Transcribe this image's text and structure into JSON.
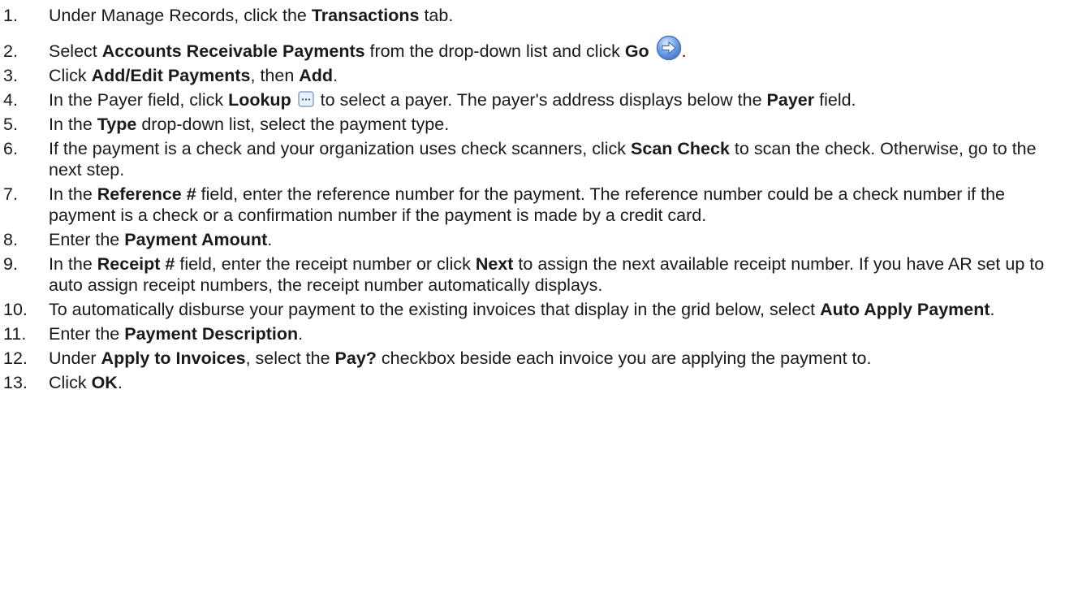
{
  "steps": [
    {
      "num": "1.",
      "parts": [
        {
          "t": "Under Manage Records, click the "
        },
        {
          "t": "Transactions",
          "b": true
        },
        {
          "t": " tab."
        }
      ]
    },
    {
      "num": "2.",
      "parts": [
        {
          "t": "Select "
        },
        {
          "t": "Accounts Receivable Payments",
          "b": true
        },
        {
          "t": " from the drop-down list and click "
        },
        {
          "t": "Go",
          "b": true
        },
        {
          "t": " "
        },
        {
          "icon": "go-arrow-icon"
        },
        {
          "t": "."
        }
      ]
    },
    {
      "num": "3.",
      "parts": [
        {
          "t": "Click "
        },
        {
          "t": "Add/Edit Payments",
          "b": true
        },
        {
          "t": ", then "
        },
        {
          "t": "Add",
          "b": true
        },
        {
          "t": "."
        }
      ]
    },
    {
      "num": "4.",
      "parts": [
        {
          "t": "In the Payer field, click "
        },
        {
          "t": "Lookup",
          "b": true
        },
        {
          "t": " "
        },
        {
          "icon": "lookup-icon"
        },
        {
          "t": " to select a payer. The payer's address displays below the "
        },
        {
          "t": "Payer",
          "b": true
        },
        {
          "t": " field."
        }
      ]
    },
    {
      "num": "5.",
      "parts": [
        {
          "t": "In the "
        },
        {
          "t": "Type",
          "b": true
        },
        {
          "t": " drop-down list, select the payment type."
        }
      ]
    },
    {
      "num": "6.",
      "parts": [
        {
          "t": "If the payment is a check and your organization uses check scanners, click "
        },
        {
          "t": "Scan Check",
          "b": true
        },
        {
          "t": " to scan the check. Otherwise, go to the next step."
        }
      ]
    },
    {
      "num": "7.",
      "parts": [
        {
          "t": "In the "
        },
        {
          "t": "Reference #",
          "b": true
        },
        {
          "t": " field, enter the reference number for the payment. The reference number could be a check number if the payment is a check or a confirmation number if the payment is made by a credit card."
        }
      ]
    },
    {
      "num": "8.",
      "parts": [
        {
          "t": "Enter the "
        },
        {
          "t": "Payment Amount",
          "b": true
        },
        {
          "t": "."
        }
      ]
    },
    {
      "num": "9.",
      "parts": [
        {
          "t": "In the "
        },
        {
          "t": "Receipt #",
          "b": true
        },
        {
          "t": " field, enter the receipt number or click "
        },
        {
          "t": "Next",
          "b": true
        },
        {
          "t": " to assign the next available receipt number. If you have AR set up to auto assign receipt numbers, the receipt number automatically displays."
        }
      ]
    },
    {
      "num": "10.",
      "parts": [
        {
          "t": "To automatically disburse your payment to the existing invoices that display in the grid below, select "
        },
        {
          "t": "Auto Apply Payment",
          "b": true
        },
        {
          "t": "."
        }
      ]
    },
    {
      "num": "11.",
      "parts": [
        {
          "t": "Enter the "
        },
        {
          "t": "Payment Description",
          "b": true
        },
        {
          "t": "."
        }
      ]
    },
    {
      "num": "12.",
      "parts": [
        {
          "t": "Under "
        },
        {
          "t": "Apply to Invoices",
          "b": true
        },
        {
          "t": ", select the "
        },
        {
          "t": "Pay?",
          "b": true
        },
        {
          "t": " checkbox beside each invoice you are applying the payment to."
        }
      ]
    },
    {
      "num": "13.",
      "parts": [
        {
          "t": "Click "
        },
        {
          "t": "OK",
          "b": true
        },
        {
          "t": "."
        }
      ]
    }
  ],
  "colors": {
    "go_icon_outer": "#4a78c8",
    "go_icon_inner": "#6f9fe6",
    "lookup_icon_border": "#6b8fb8",
    "lookup_icon_fill": "#e8f0fb"
  }
}
